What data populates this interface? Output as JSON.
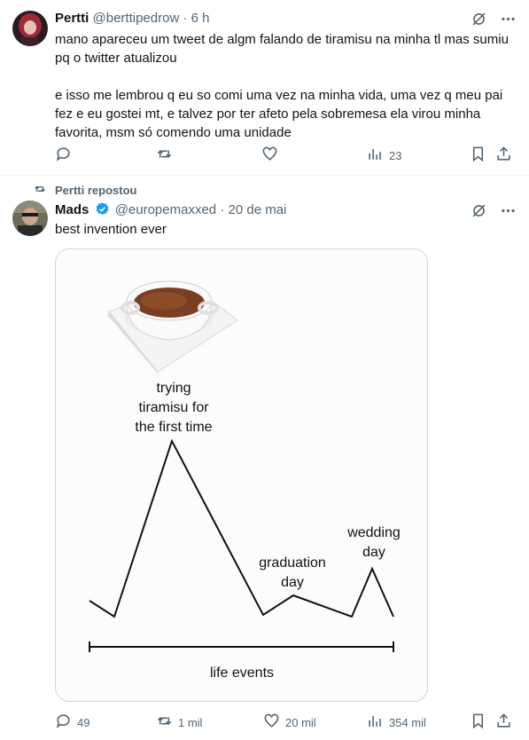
{
  "tweet1": {
    "name": "Pertti",
    "handle": "@berttipedrow",
    "separator": "·",
    "time": "6 h",
    "paragraph1": "mano apareceu um tweet de algm falando de tiramisu na minha tl mas sumiu pq o twitter atualizou",
    "paragraph2": "e isso me lembrou q eu so comi uma vez na minha vida, uma vez q meu pai fez e eu gostei mt, e talvez por ter afeto pela sobremesa ela virou minha favorita, msm só comendo uma unidade",
    "views": "23"
  },
  "repost": {
    "label": "Pertti repostou"
  },
  "tweet2": {
    "name": "Mads",
    "handle": "@europemaxxed",
    "separator": "·",
    "time": "20 de mai",
    "text": "best invention ever",
    "replies": "49",
    "reposts": "1 mil",
    "likes": "20 mil",
    "views": "354 mil"
  },
  "chart": {
    "peak_label_1": "trying",
    "peak_label_2": "tiramisu for",
    "peak_label_3": "the first time",
    "graduation_1": "graduation",
    "graduation_2": "day",
    "wedding_1": "wedding",
    "wedding_2": "day",
    "axis_label": "life events"
  },
  "colors": {
    "text": "#0f1419",
    "secondary": "#536471",
    "verified": "#1d9bf0",
    "border": "#cfd9de"
  },
  "icons": [
    "grok-icon",
    "more-icon",
    "reply-icon",
    "repost-icon",
    "like-icon",
    "views-icon",
    "bookmark-icon",
    "share-icon",
    "verified-icon"
  ]
}
